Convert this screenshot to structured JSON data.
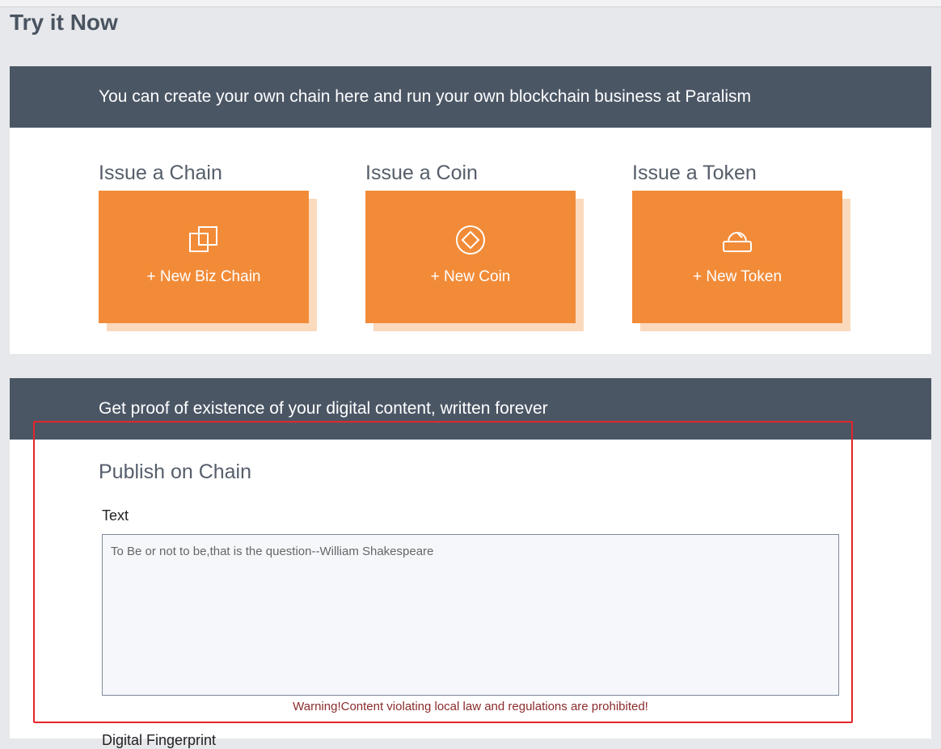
{
  "page": {
    "title": "Try it Now"
  },
  "section1": {
    "banner": "You can create your own chain here and run your own blockchain business at Paralism",
    "cards": [
      {
        "title": "Issue a Chain",
        "button": "+ New Biz Chain",
        "icon": "chain-icon"
      },
      {
        "title": "Issue a Coin",
        "button": "+ New Coin",
        "icon": "coin-icon"
      },
      {
        "title": "Issue a Token",
        "button": "+ New Token",
        "icon": "token-icon"
      }
    ]
  },
  "section2": {
    "banner": "Get proof of existence of your digital content, written forever",
    "publish_title": "Publish on Chain",
    "text_label": "Text",
    "text_placeholder": "To Be or not to be,that is the question--William Shakespeare",
    "text_value": "",
    "warning": "Warning!Content violating local law and regulations are prohibited!",
    "next_label": "Digital Fingerprint"
  },
  "colors": {
    "banner": "#4b5665",
    "card": "#f28b38",
    "card_shadow": "#fbd9bd",
    "warning": "#8b2b2b",
    "highlight": "#e3262a"
  }
}
